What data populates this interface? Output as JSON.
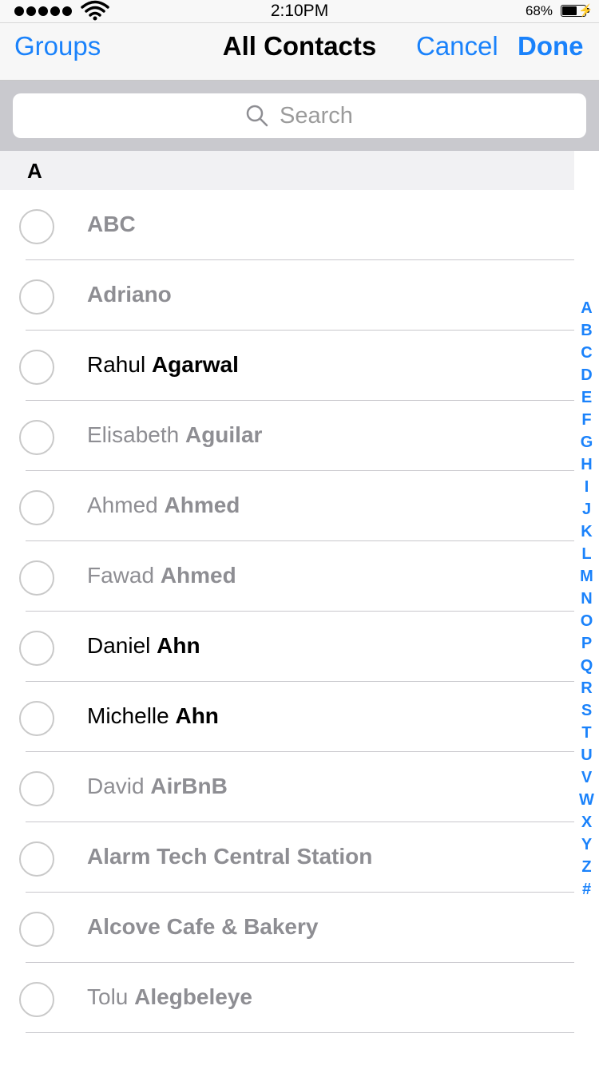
{
  "status_bar": {
    "time": "2:10PM",
    "battery_percent": "68%",
    "battery_level": 0.68,
    "signal_bars": 5,
    "wifi_icon": "wifi-icon",
    "charging_icon": "lightning-bolt-icon"
  },
  "nav": {
    "groups_label": "Groups",
    "title": "All Contacts",
    "cancel_label": "Cancel",
    "done_label": "Done"
  },
  "search": {
    "placeholder": "Search",
    "icon": "search-icon"
  },
  "section": {
    "letter": "A"
  },
  "contacts": [
    {
      "first": "",
      "last": "ABC",
      "dimmed": true
    },
    {
      "first": "",
      "last": "Adriano",
      "dimmed": true
    },
    {
      "first": "Rahul",
      "last": "Agarwal",
      "dimmed": false
    },
    {
      "first": "Elisabeth",
      "last": "Aguilar",
      "dimmed": true
    },
    {
      "first": "Ahmed",
      "last": "Ahmed",
      "dimmed": true
    },
    {
      "first": "Fawad",
      "last": "Ahmed",
      "dimmed": true
    },
    {
      "first": "Daniel",
      "last": "Ahn",
      "dimmed": false
    },
    {
      "first": "Michelle",
      "last": "Ahn",
      "dimmed": false
    },
    {
      "first": "David",
      "last": "AirBnB",
      "dimmed": true
    },
    {
      "first": "",
      "last": "Alarm Tech Central Station",
      "dimmed": true
    },
    {
      "first": "",
      "last": "Alcove Cafe & Bakery",
      "dimmed": true
    },
    {
      "first": "Tolu",
      "last": "Alegbeleye",
      "dimmed": true
    }
  ],
  "index_letters": [
    "A",
    "B",
    "C",
    "D",
    "E",
    "F",
    "G",
    "H",
    "I",
    "J",
    "K",
    "L",
    "M",
    "N",
    "O",
    "P",
    "Q",
    "R",
    "S",
    "T",
    "U",
    "V",
    "W",
    "X",
    "Y",
    "Z",
    "#"
  ],
  "colors": {
    "accent": "#1a82fb",
    "dimmed_text": "#8e8e93",
    "search_background": "#c9c9ce"
  }
}
